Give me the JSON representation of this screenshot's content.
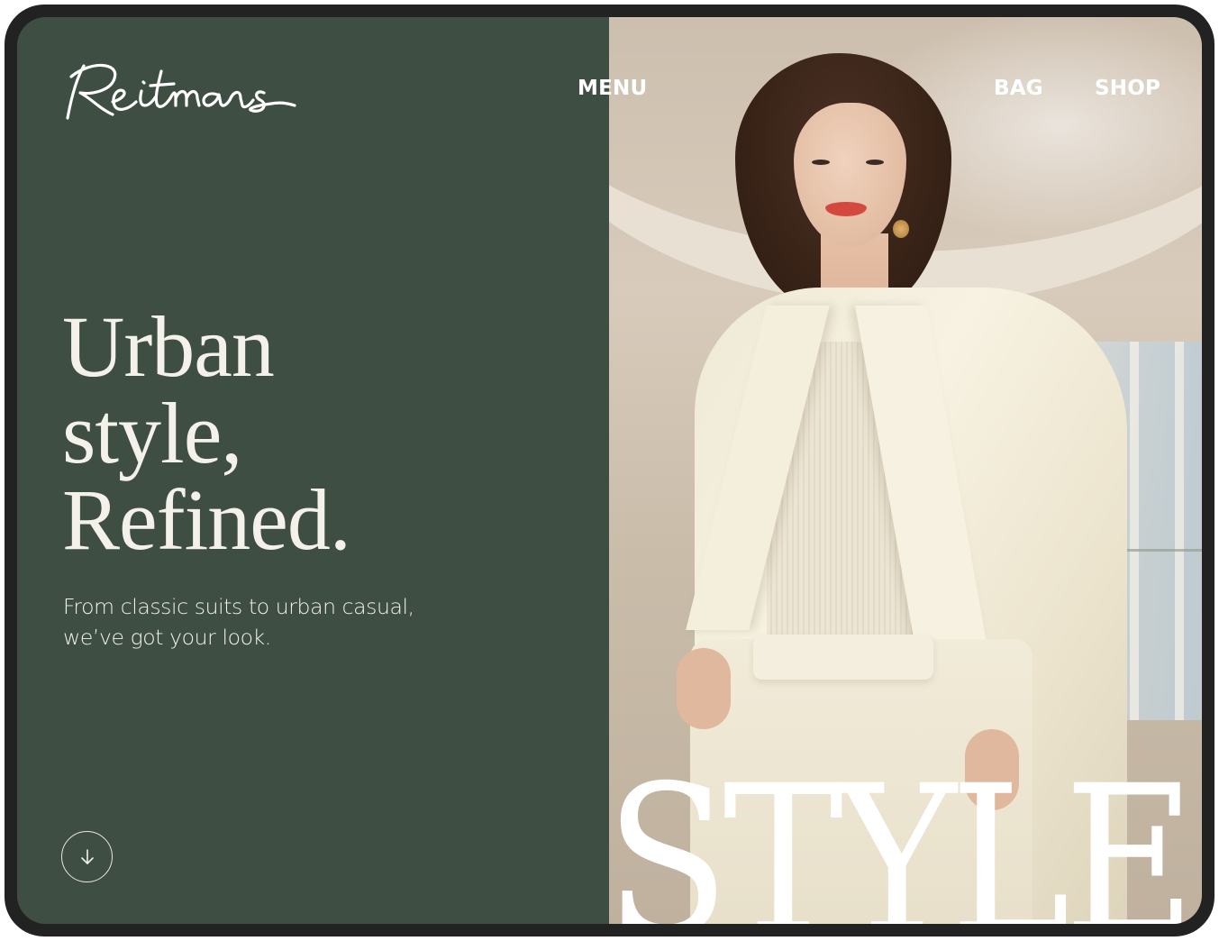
{
  "brand": {
    "logo_text": "Reitmans"
  },
  "nav": {
    "menu_label": "MENU",
    "bag_label": "BAG",
    "shop_label": "SHOP"
  },
  "hero": {
    "title_lines": [
      "Urban",
      "style,",
      "Refined."
    ],
    "subtitle_lines": [
      "From classic suits to urban casual,",
      "we’ve got your look."
    ],
    "scroll_icon": "arrow-down-icon"
  },
  "photo": {
    "overlay_word": "STYLE"
  },
  "colors": {
    "panel_green": "#3f4e42",
    "text_light": "#f3f1ea",
    "device_frame": "#222222"
  }
}
